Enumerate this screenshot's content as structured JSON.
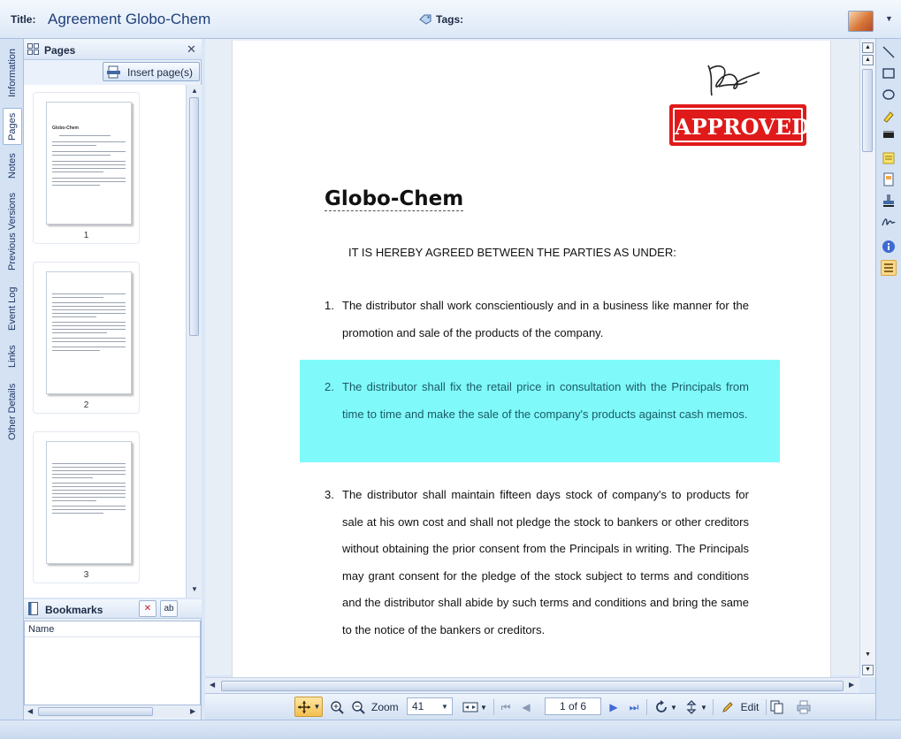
{
  "header": {
    "title_label": "Title:",
    "title_value": "Agreement Globo-Chem",
    "tags_label": "Tags:"
  },
  "left_tabs": [
    "Information",
    "Pages",
    "Notes",
    "Previous Versions",
    "Event Log",
    "Links",
    "Other Details"
  ],
  "pages_panel": {
    "title": "Pages",
    "insert_label": "Insert page(s)",
    "thumbnails": [
      {
        "number": "1",
        "heading": "Globo-Chem"
      },
      {
        "number": "2"
      },
      {
        "number": "3"
      }
    ]
  },
  "bookmarks": {
    "title": "Bookmarks",
    "column_name": "Name"
  },
  "document": {
    "stamp_text": "APPROVED",
    "title": "Globo-Chem",
    "intro": "IT IS HEREBY AGREED BETWEEN THE PARTIES AS UNDER:",
    "clauses": [
      {
        "num": "1.",
        "text": "The distributor shall work conscientiously and in a business like manner for the promotion and sale of the products of the company."
      },
      {
        "num": "2.",
        "text": "The distributor shall fix the retail price in consultation with the Principals from time to time and make the sale of the company's products against cash memos."
      },
      {
        "num": "3.",
        "text": "The distributor shall maintain fifteen days stock of company's to products for sale at his own cost and shall not pledge the stock to bankers or other creditors without obtaining the prior consent from the Principals in writing. The Principals may grant consent for the pledge of the stock subject to terms and conditions and the distributor shall abide by such terms and conditions and bring the same to the notice of the bankers or creditors."
      }
    ],
    "highlight_color": "#7ff9fa",
    "stamp_color": "#e01a1a"
  },
  "bottom_toolbar": {
    "zoom_label": "Zoom",
    "zoom_value": "41",
    "page_indicator": "1 of 6",
    "edit_label": "Edit"
  },
  "colors": {
    "accent": "#1f3f7a",
    "panel_bg": "#d4e2f4",
    "active_tool": "#fbd889"
  }
}
